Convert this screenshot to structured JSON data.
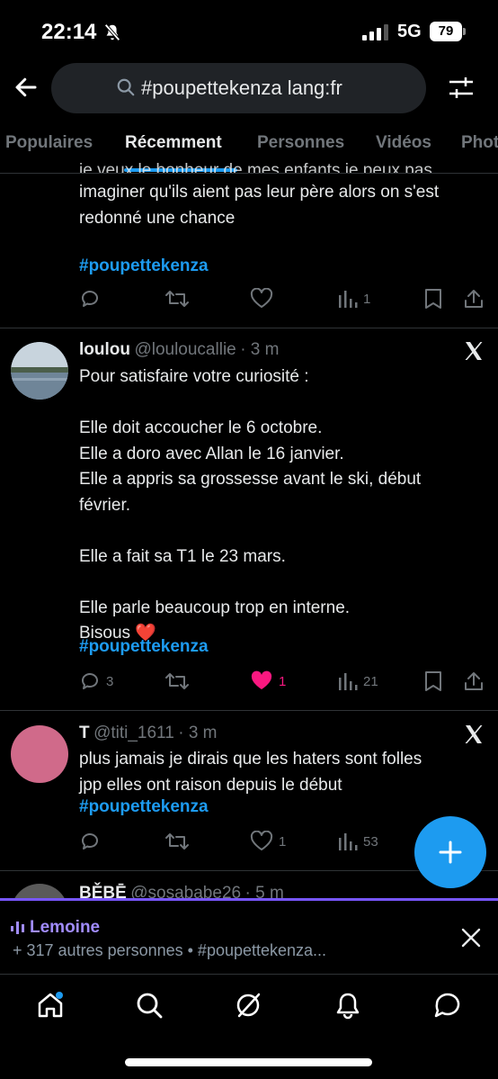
{
  "status_bar": {
    "time": "22:14",
    "network": "5G",
    "battery": "79"
  },
  "search": {
    "query": "#poupettekenza lang:fr"
  },
  "tabs": [
    {
      "label": "Populaires"
    },
    {
      "label": "Récemment"
    },
    {
      "label": "Personnes"
    },
    {
      "label": "Vidéos"
    },
    {
      "label": "Photos"
    }
  ],
  "active_tab": "Récemment",
  "tweets": [
    {
      "partial_top_line": "je veux le bonheur de mes enfants je peux pas",
      "text": "imaginer qu'ils aient pas leur père alors on s'est\nredonné une chance",
      "hashtag": "#poupettekenza",
      "replies": "",
      "retweets": "",
      "likes": "",
      "views": "1"
    },
    {
      "name": "loulou",
      "handle": "@louloucallie",
      "time": "· 3 m",
      "text": "Pour satisfaire votre curiosité :\n\nElle doit accoucher le 6 octobre.\nElle a doro avec Allan le 16 janvier.\nElle a appris sa grossesse avant le ski, début\nfévrier.\n\nElle a fait sa T1 le 23 mars.\n\nElle parle beaucoup trop en interne.\nBisous ❤️",
      "hashtag": "#poupettekenza",
      "replies": "3",
      "retweets": "",
      "likes": "1",
      "views": "21",
      "liked": true
    },
    {
      "name": "T",
      "handle": "@titi_1611",
      "time": "· 3 m",
      "text": "plus jamais je dirais que les haters sont folles\njpp elles ont raison depuis le début",
      "hashtag": "#poupettekenza",
      "replies": "",
      "retweets": "",
      "likes": "1",
      "views": "53",
      "avatar_color": "#d06a8a"
    },
    {
      "name": "BĚBĒ",
      "handle": "@sosababe26",
      "time": "· 5 m"
    }
  ],
  "spaces": {
    "title": "Lemoine",
    "subtitle": "+ 317 autres personnes • #poupettekenza..."
  },
  "colors": {
    "accent": "#1d9bf0",
    "like": "#f91880",
    "spaces": "#7856ff"
  },
  "nav": [
    "home-icon",
    "search-icon",
    "grok-icon",
    "notifications-icon",
    "messages-icon"
  ]
}
